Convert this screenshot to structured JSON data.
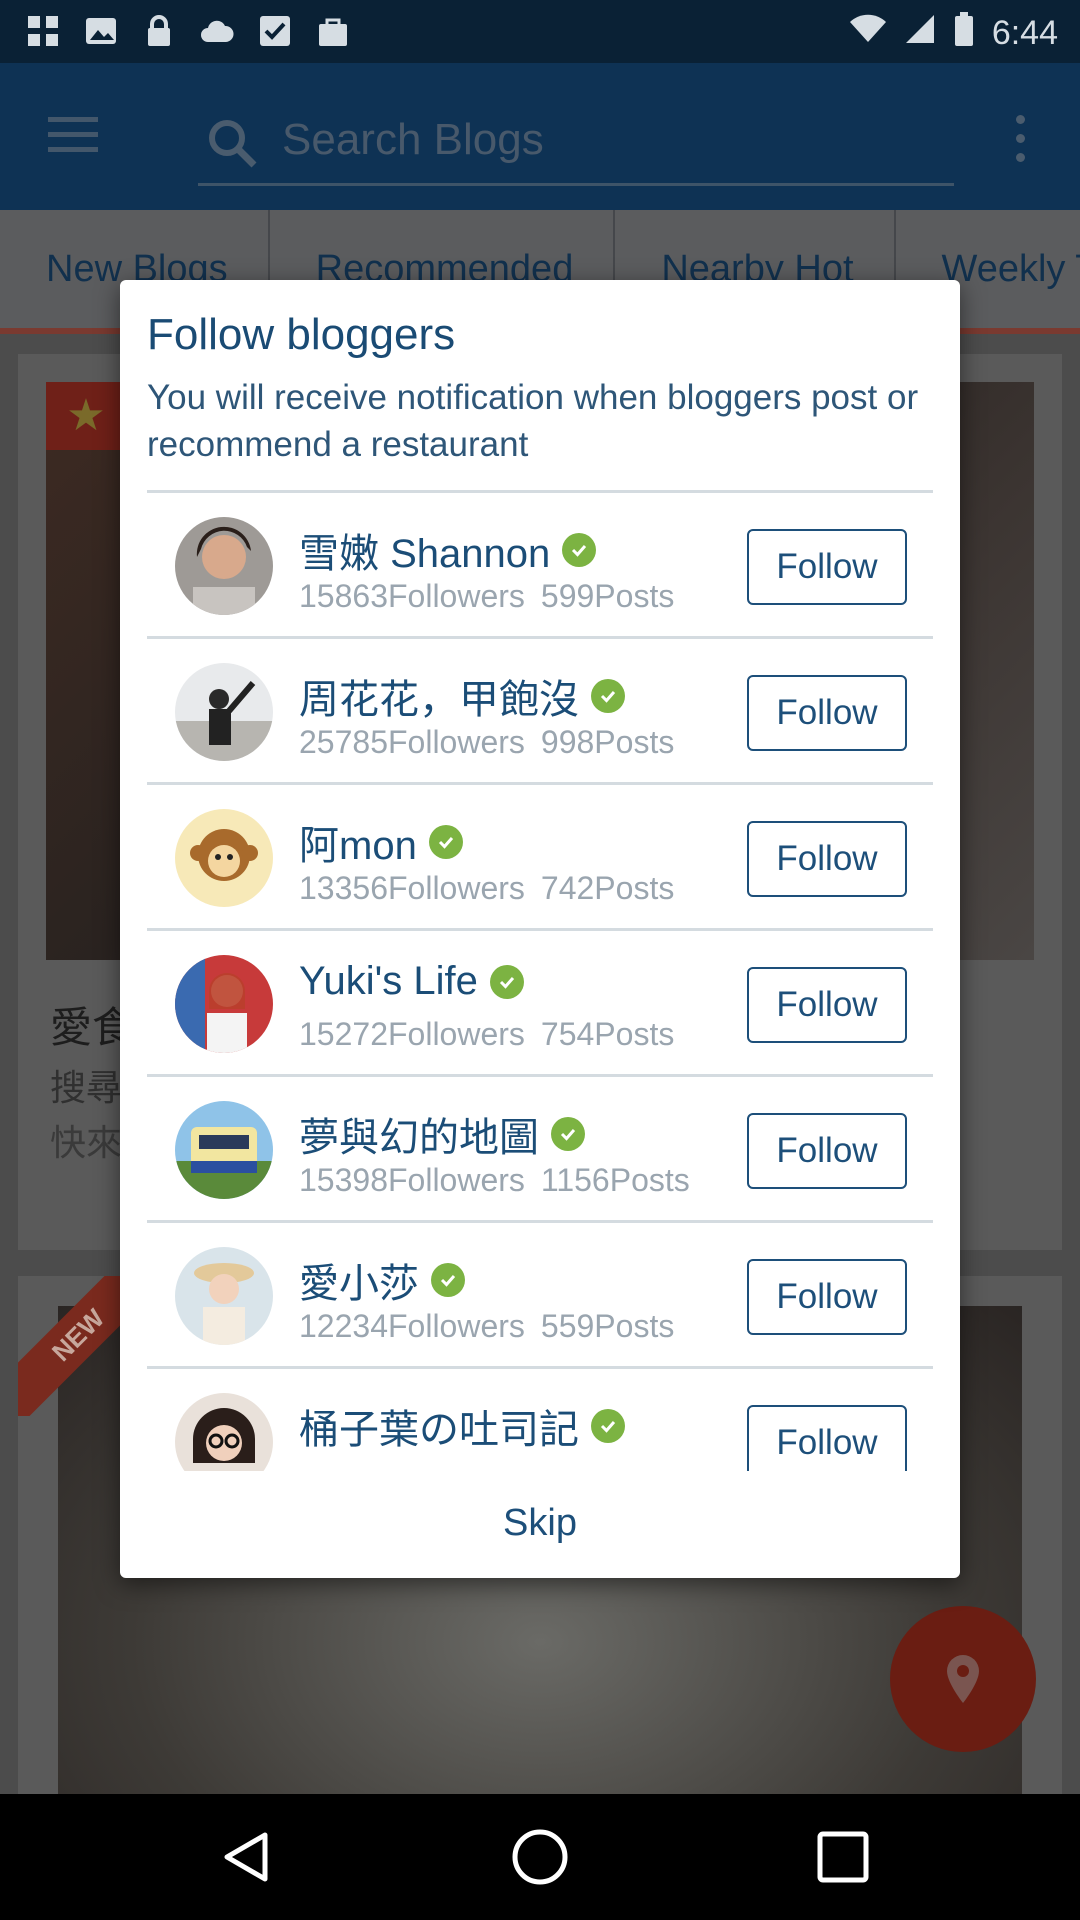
{
  "status_bar": {
    "time": "6:44",
    "left_icons": [
      "grid-icon",
      "image-icon",
      "lock-icon",
      "cloud-icon",
      "check-box-icon",
      "bag-icon"
    ],
    "right_icons": [
      "wifi-icon",
      "signal-icon",
      "battery-icon"
    ]
  },
  "app_bar": {
    "search_placeholder": "Search Blogs"
  },
  "tabs": [
    {
      "label": "New Blogs"
    },
    {
      "label": "Recommended"
    },
    {
      "label": "Nearby Hot"
    },
    {
      "label": "Weekly T"
    }
  ],
  "background_feed": {
    "card1_title": "愛食",
    "card1_line1": "搜尋",
    "card1_line2": "快來",
    "card2_badge": "NEW"
  },
  "dialog": {
    "title": "Follow bloggers",
    "message": "You will receive notification when bloggers post or recommend a restaurant",
    "skip_label": "Skip",
    "bloggers": [
      {
        "name": "雪嫩 Shannon",
        "followers": "15863Followers",
        "posts": "599Posts",
        "follow_label": "Follow"
      },
      {
        "name": "周花花，甲飽沒",
        "followers": "25785Followers",
        "posts": "998Posts",
        "follow_label": "Follow"
      },
      {
        "name": "阿mon",
        "followers": "13356Followers",
        "posts": "742Posts",
        "follow_label": "Follow"
      },
      {
        "name": "Yuki's Life",
        "followers": "15272Followers",
        "posts": "754Posts",
        "follow_label": "Follow"
      },
      {
        "name": "夢與幻的地圖",
        "followers": "15398Followers",
        "posts": "1156Posts",
        "follow_label": "Follow"
      },
      {
        "name": "愛小莎",
        "followers": "12234Followers",
        "posts": "559Posts",
        "follow_label": "Follow"
      },
      {
        "name": "桶子葉の吐司記",
        "followers": "",
        "posts": "",
        "follow_label": "Follow"
      }
    ]
  },
  "colors": {
    "accent_blue": "#1d4f7a",
    "verified_green": "#7cb342",
    "app_bar": "#0e3254"
  }
}
